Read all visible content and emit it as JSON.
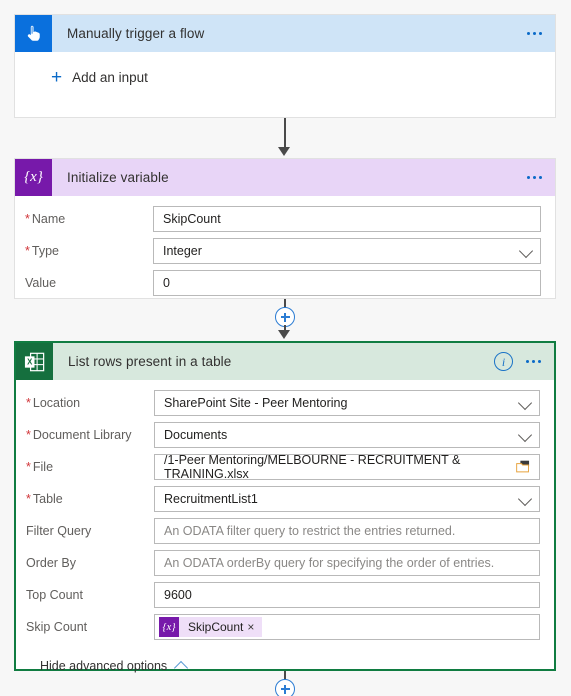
{
  "background_color": "#f7f7f7",
  "colors": {
    "trigger_header": "#cfe4f7",
    "trigger_icon": "#0a70dd",
    "variable_header": "#e8d5f7",
    "variable_icon": "#7719aa",
    "excel_header": "#d7e8dd",
    "excel_icon": "#156f3e",
    "selected_border": "#107c41",
    "accent_link": "#0b6ac8",
    "required_asterisk": "#d13438",
    "token_background": "#efdff8"
  },
  "cards": {
    "trigger": {
      "icon": "hand-pointer-icon",
      "title": "Manually trigger a flow",
      "menu_icon": "ellipsis-icon",
      "add_input": {
        "icon": "plus-icon",
        "label": "Add an input"
      }
    },
    "initialize_variable": {
      "icon": "variable-braces-icon",
      "icon_glyph": "{x}",
      "title": "Initialize variable",
      "menu_icon": "ellipsis-icon",
      "fields": [
        {
          "label": "Name",
          "required": true,
          "value": "SkipCount",
          "placeholder": "",
          "control": "text"
        },
        {
          "label": "Type",
          "required": true,
          "value": "Integer",
          "placeholder": "",
          "control": "dropdown"
        },
        {
          "label": "Value",
          "required": false,
          "value": "0",
          "placeholder": "",
          "control": "text"
        }
      ]
    },
    "list_rows": {
      "icon": "excel-table-icon",
      "title": "List rows present in a table",
      "info_icon": "info-circle-icon",
      "menu_icon": "ellipsis-icon",
      "selected": true,
      "fields": [
        {
          "label": "Location",
          "required": true,
          "value": "SharePoint Site - Peer Mentoring",
          "placeholder": "",
          "control": "dropdown"
        },
        {
          "label": "Document Library",
          "required": true,
          "value": "Documents",
          "placeholder": "",
          "control": "dropdown"
        },
        {
          "label": "File",
          "required": true,
          "value": "/1-Peer Mentoring/MELBOURNE - RECRUITMENT & TRAINING.xlsx",
          "placeholder": "",
          "control": "filepicker"
        },
        {
          "label": "Table",
          "required": true,
          "value": "RecruitmentList1",
          "placeholder": "",
          "control": "dropdown"
        },
        {
          "label": "Filter Query",
          "required": false,
          "value": "",
          "placeholder": "An ODATA filter query to restrict the entries returned.",
          "control": "text"
        },
        {
          "label": "Order By",
          "required": false,
          "value": "",
          "placeholder": "An ODATA orderBy query for specifying the order of entries.",
          "control": "text"
        },
        {
          "label": "Top Count",
          "required": false,
          "value": "9600",
          "placeholder": "",
          "control": "text"
        },
        {
          "label": "Skip Count",
          "required": false,
          "value": "",
          "placeholder": "",
          "control": "token"
        }
      ],
      "token": {
        "icon_glyph": "{x}",
        "label": "SkipCount",
        "remove_icon": "close-icon",
        "remove_glyph": "×"
      },
      "advanced_toggle": {
        "label": "Hide advanced options",
        "icon": "chevron-up-icon"
      }
    }
  },
  "connectors": {
    "trigger_to_variable": {
      "type": "arrow",
      "icon": "down-arrow-icon"
    },
    "variable_to_list_rows": {
      "type": "insert-node",
      "icon": "plus-circle-icon"
    },
    "after_list_rows": {
      "type": "insert-node",
      "icon": "plus-circle-icon"
    }
  }
}
